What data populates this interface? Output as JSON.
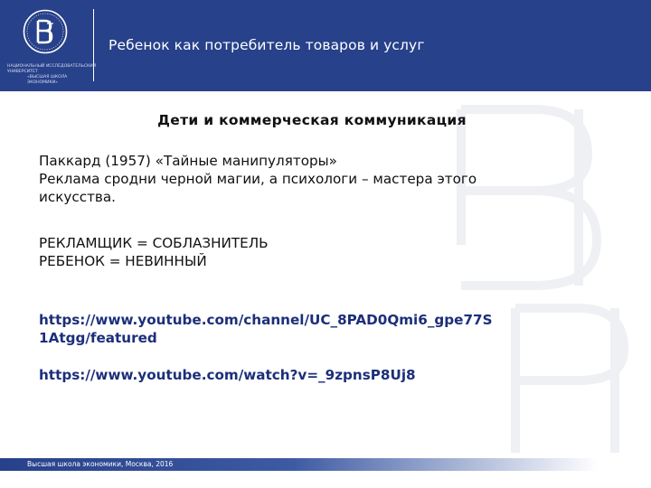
{
  "header": {
    "title": "Ребенок как потребитель товаров и услуг",
    "logo_text_1": "НАЦИОНАЛЬНЫЙ ИССЛЕДОВАТЕЛЬСКИЙ УНИВЕРСИТЕТ",
    "logo_text_2": "«ВЫСШАЯ ШКОЛА ЭКОНОМИКИ»"
  },
  "content": {
    "heading": "Дети и коммерческая коммуникация",
    "para1": [
      "Паккард (1957) «Тайные манипуляторы»",
      "Реклама сродни черной магии, а психологи – мастера этого",
      "искусства."
    ],
    "para2": [
      "РЕКЛАМЩИК = СОБЛАЗНИТЕЛЬ",
      "РЕБЕНОК = НЕВИННЫЙ"
    ],
    "link1": [
      "https://www.youtube.com/channel/UC_8PAD0Qmi6_gpe77S",
      "1Atgg/featured"
    ],
    "link2": "https://www.youtube.com/watch?v=_9zpnsP8Uj8"
  },
  "footer": {
    "text": "Высшая школа экономики, Москва, 2016"
  },
  "colors": {
    "brand": "#27418a",
    "link": "#1c2f7a",
    "text": "#111111"
  }
}
